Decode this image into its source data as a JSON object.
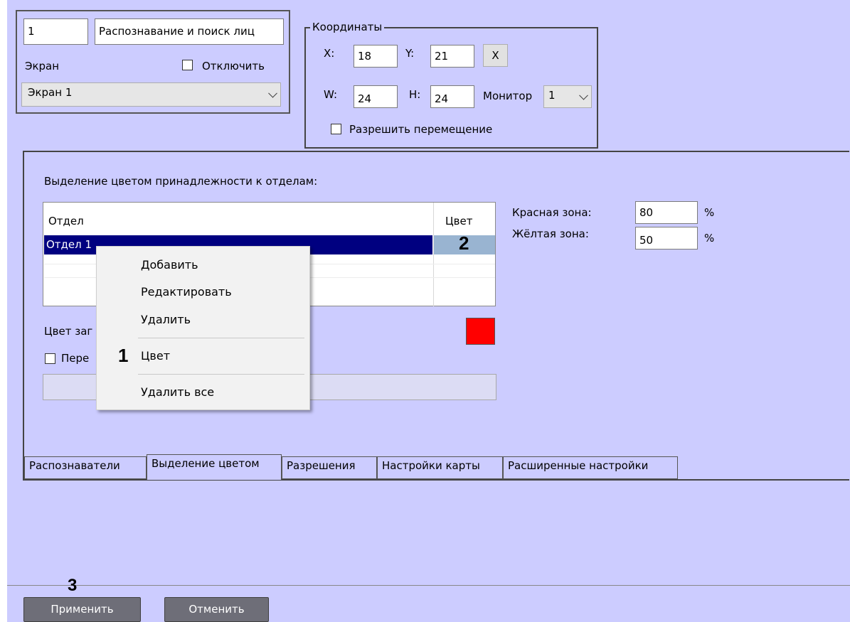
{
  "header": {
    "id_value": "1",
    "name_value": "Распознавание и поиск лиц",
    "screen_label": "Экран",
    "disable_label": "Отключить",
    "screen_select": "Экран 1"
  },
  "coords": {
    "title": "Координаты",
    "x_label": "X:",
    "x_value": "18",
    "y_label": "Y:",
    "y_value": "21",
    "clear_label": "X",
    "w_label": "W:",
    "w_value": "24",
    "h_label": "H:",
    "h_value": "24",
    "monitor_label": "Монитор",
    "monitor_value": "1",
    "allow_move_label": "Разрешить перемещение"
  },
  "color_tab": {
    "section_title": "Выделение цветом принадлежности к отделам:",
    "table": {
      "headers": [
        "Отдел",
        "Цвет"
      ],
      "rows": [
        [
          "Отдел 1",
          ""
        ]
      ]
    },
    "red_zone_label": "Красная зона:",
    "red_zone_value": "80",
    "yellow_zone_label": "Жёлтая зона:",
    "yellow_zone_value": "50",
    "percent": "%",
    "swatch_color": "#ff0000",
    "background_color_label": "Цвет заг",
    "override_label": "Пере"
  },
  "context_menu": {
    "items": [
      "Добавить",
      "Редактировать",
      "Удалить",
      "Цвет",
      "Удалить все"
    ]
  },
  "markers": [
    "1",
    "2",
    "3"
  ],
  "tabs": [
    "Распознаватели",
    "Выделение цветом",
    "Разрешения",
    "Настройки карты",
    "Расширенные настройки"
  ],
  "buttons": {
    "apply": "Применить",
    "cancel": "Отменить"
  },
  "colors": {
    "panel": "#ccccff",
    "selection": "#000080",
    "swatch": "#ff0000"
  }
}
